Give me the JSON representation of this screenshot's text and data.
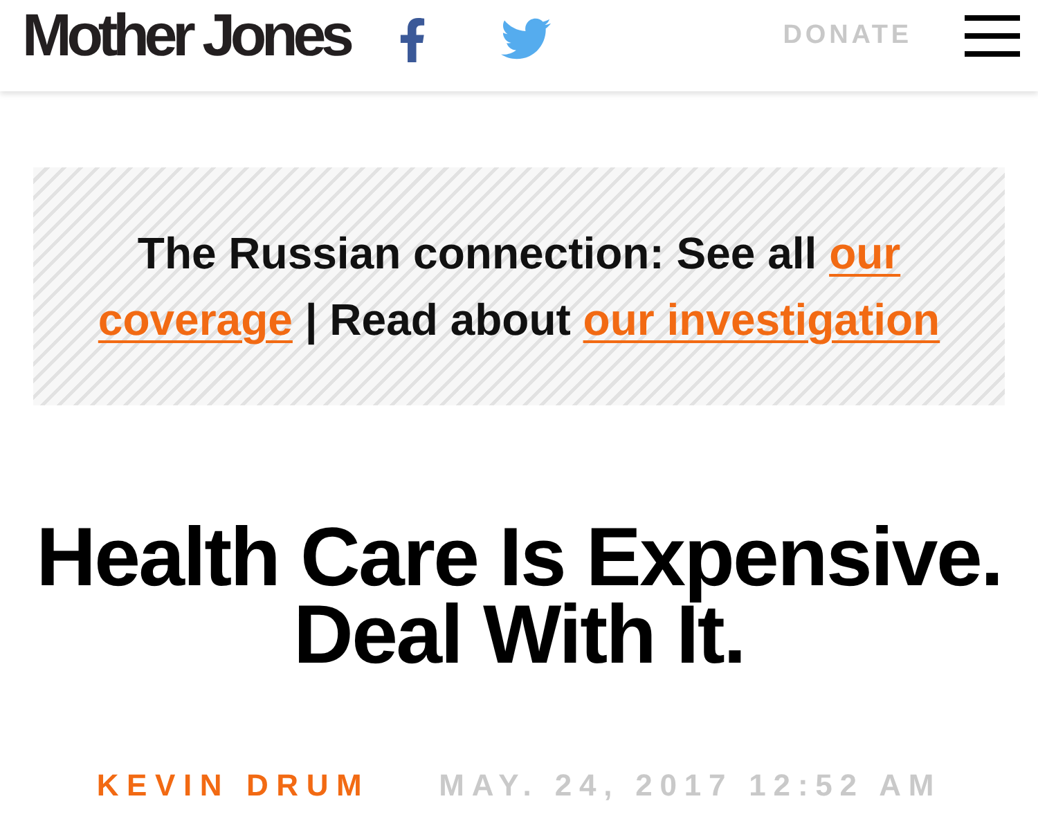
{
  "header": {
    "logo": "Mother Jones",
    "social": [
      {
        "kind": "facebook"
      },
      {
        "kind": "twitter"
      }
    ],
    "donate": "DONATE"
  },
  "banner": {
    "lines": [
      [
        {
          "kind": "text",
          "text": "The Russian connection: See all "
        },
        {
          "kind": "link",
          "text": "our"
        }
      ],
      [
        {
          "kind": "link",
          "text": "coverage"
        },
        {
          "kind": "text",
          "text": " | Read about "
        },
        {
          "kind": "link",
          "text": "our investigation"
        }
      ]
    ]
  },
  "article": {
    "headline": "Health Care Is Expensive. Deal With It.",
    "author": "KEVIN DRUM",
    "date": "MAY. 24, 2017 12:52 AM"
  }
}
